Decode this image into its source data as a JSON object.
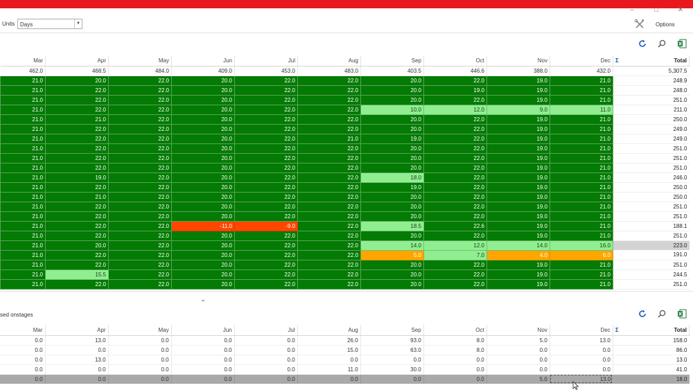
{
  "window": {
    "title_bar_color": "#e8181e",
    "controls": [
      "minimize-icon",
      "maximize-icon",
      "close-icon"
    ],
    "control_glyphs": [
      "–",
      "□",
      "✕"
    ]
  },
  "toolbar": {
    "units_label": "Units",
    "units_value": "Days",
    "options_label": "Options"
  },
  "colors": {
    "dark_green": "#047b04",
    "light_green": "#90ee90",
    "orange": "#ffa500",
    "red": "#ff4500",
    "selected_row": "#a9a9a9"
  },
  "grid1": {
    "columns": [
      "Mar",
      "Apr",
      "May",
      "Jun",
      "Jul",
      "Aug",
      "Sep",
      "Oct",
      "Nov",
      "Dec"
    ],
    "total_label": "Total",
    "sigma": "Σ",
    "summary": [
      "462.0",
      "468.5",
      "484.0",
      "409.0",
      "453.0",
      "483.0",
      "403.5",
      "446.6",
      "388.0",
      "432.0",
      "5,307.5"
    ],
    "rows": [
      {
        "v": [
          "21.0",
          "20.0",
          "22.0",
          "20.0",
          "22.0",
          "22.0",
          "20.0",
          "22.0",
          "19.0",
          "21.0"
        ],
        "c": "gggggggggg",
        "t": "248.9"
      },
      {
        "v": [
          "21.0",
          "22.0",
          "22.0",
          "20.0",
          "22.0",
          "22.0",
          "20.0",
          "19.0",
          "19.0",
          "21.0"
        ],
        "c": "gggggggggg",
        "t": "248.0"
      },
      {
        "v": [
          "21.0",
          "22.0",
          "22.0",
          "20.0",
          "22.0",
          "22.0",
          "20.0",
          "22.0",
          "19.0",
          "21.0"
        ],
        "c": "gggggggggg",
        "t": "251.0"
      },
      {
        "v": [
          "21.0",
          "22.0",
          "22.0",
          "20.0",
          "22.0",
          "22.0",
          "10.0",
          "12.0",
          "9.0",
          "11.0"
        ],
        "c": "ggggggllll",
        "t": "211.0"
      },
      {
        "v": [
          "21.0",
          "21.0",
          "22.0",
          "20.0",
          "22.0",
          "22.0",
          "20.0",
          "22.0",
          "19.0",
          "21.0"
        ],
        "c": "gggggggggg",
        "t": "250.0"
      },
      {
        "v": [
          "21.0",
          "22.0",
          "22.0",
          "20.0",
          "22.0",
          "22.0",
          "20.0",
          "22.0",
          "19.0",
          "21.0"
        ],
        "c": "gggggggggg",
        "t": "249.0"
      },
      {
        "v": [
          "21.0",
          "22.0",
          "22.0",
          "20.0",
          "22.0",
          "21.0",
          "19.0",
          "22.0",
          "19.0",
          "21.0"
        ],
        "c": "gggggggggg",
        "t": "249.0"
      },
      {
        "v": [
          "21.0",
          "22.0",
          "22.0",
          "20.0",
          "22.0",
          "22.0",
          "20.0",
          "22.0",
          "19.0",
          "21.0"
        ],
        "c": "gggggggggg",
        "t": "251.0"
      },
      {
        "v": [
          "21.0",
          "22.0",
          "22.0",
          "20.0",
          "22.0",
          "22.0",
          "20.0",
          "22.0",
          "19.0",
          "21.0"
        ],
        "c": "gggggggggg",
        "t": "251.0"
      },
      {
        "v": [
          "21.0",
          "22.0",
          "22.0",
          "20.0",
          "22.0",
          "22.0",
          "20.0",
          "22.0",
          "19.0",
          "21.0"
        ],
        "c": "gggggggggg",
        "t": "251.0"
      },
      {
        "v": [
          "21.0",
          "19.0",
          "22.0",
          "20.0",
          "22.0",
          "22.0",
          "18.0",
          "22.0",
          "19.0",
          "21.0"
        ],
        "c": "ggggggLggg",
        "t": "246.0"
      },
      {
        "v": [
          "21.0",
          "22.0",
          "22.0",
          "20.0",
          "22.0",
          "22.0",
          "19.0",
          "22.0",
          "19.0",
          "21.0"
        ],
        "c": "gggggggggg",
        "t": "250.0"
      },
      {
        "v": [
          "21.0",
          "21.0",
          "22.0",
          "20.0",
          "22.0",
          "22.0",
          "20.0",
          "22.0",
          "19.0",
          "21.0"
        ],
        "c": "gggggggggg",
        "t": "250.0"
      },
      {
        "v": [
          "21.0",
          "22.0",
          "22.0",
          "20.0",
          "22.0",
          "22.0",
          "20.0",
          "22.0",
          "19.0",
          "21.0"
        ],
        "c": "gggggggggg",
        "t": "251.0"
      },
      {
        "v": [
          "21.0",
          "22.0",
          "22.0",
          "20.0",
          "22.0",
          "22.0",
          "20.0",
          "22.0",
          "19.0",
          "21.0"
        ],
        "c": "gggggggggg",
        "t": "251.0"
      },
      {
        "v": [
          "21.0",
          "22.0",
          "22.0",
          "-11.0",
          "-9.0",
          "22.0",
          "18.5",
          "22.6",
          "19.0",
          "21.0"
        ],
        "c": "gggrrgLggg",
        "t": "188.1"
      },
      {
        "v": [
          "21.0",
          "22.0",
          "22.0",
          "20.0",
          "22.0",
          "22.0",
          "20.0",
          "22.0",
          "19.0",
          "21.0"
        ],
        "c": "gggggggggg",
        "t": "251.0"
      },
      {
        "v": [
          "21.0",
          "20.0",
          "22.0",
          "20.0",
          "22.0",
          "22.0",
          "14.0",
          "12.0",
          "14.0",
          "16.0"
        ],
        "c": "ggggggllll",
        "t": "223.0",
        "sel": true
      },
      {
        "v": [
          "21.0",
          "22.0",
          "22.0",
          "20.0",
          "22.0",
          "22.0",
          "5.0",
          "7.0",
          "4.0",
          "6.0"
        ],
        "c": "ggggggoLoo",
        "t": "191.0"
      },
      {
        "v": [
          "21.0",
          "22.0",
          "22.0",
          "20.0",
          "22.0",
          "22.0",
          "20.0",
          "22.0",
          "19.0",
          "21.0"
        ],
        "c": "gggggggggg",
        "t": "251.0"
      },
      {
        "v": [
          "21.0",
          "15.5",
          "22.0",
          "20.0",
          "22.0",
          "22.0",
          "20.0",
          "22.0",
          "19.0",
          "21.0"
        ],
        "c": "gLgggggggg",
        "t": "244.5"
      },
      {
        "v": [
          "21.0",
          "22.0",
          "22.0",
          "20.0",
          "22.0",
          "22.0",
          "20.0",
          "22.0",
          "19.0",
          "21.0"
        ],
        "c": "gggggggggg",
        "t": "251.0"
      }
    ]
  },
  "section2": {
    "label": "sed onstages"
  },
  "grid2": {
    "columns": [
      "Mar",
      "Apr",
      "May",
      "Jun",
      "Jul",
      "Aug",
      "Sep",
      "Oct",
      "Nov",
      "Dec"
    ],
    "total_label": "Total",
    "sigma": "Σ",
    "rows": [
      {
        "v": [
          "0.0",
          "13.0",
          "0.0",
          "0.0",
          "0.0",
          "26.0",
          "93.0",
          "8.0",
          "5.0",
          "13.0"
        ],
        "t": "158.0"
      },
      {
        "v": [
          "0.0",
          "0.0",
          "0.0",
          "0.0",
          "0.0",
          "15.0",
          "63.0",
          "8.0",
          "0.0",
          "0.0"
        ],
        "t": "86.0"
      },
      {
        "v": [
          "0.0",
          "13.0",
          "0.0",
          "0.0",
          "0.0",
          "0.0",
          "0.0",
          "0.0",
          "0.0",
          "0.0"
        ],
        "t": "13.0"
      },
      {
        "v": [
          "0.0",
          "0.0",
          "0.0",
          "0.0",
          "0.0",
          "11.0",
          "30.0",
          "0.0",
          "0.0",
          "0.0"
        ],
        "t": "41.0"
      },
      {
        "v": [
          "0.0",
          "0.0",
          "0.0",
          "0.0",
          "0.0",
          "0.0",
          "0.0",
          "0.0",
          "5.0",
          "13.0"
        ],
        "t": "18.0",
        "sel": true
      }
    ]
  }
}
